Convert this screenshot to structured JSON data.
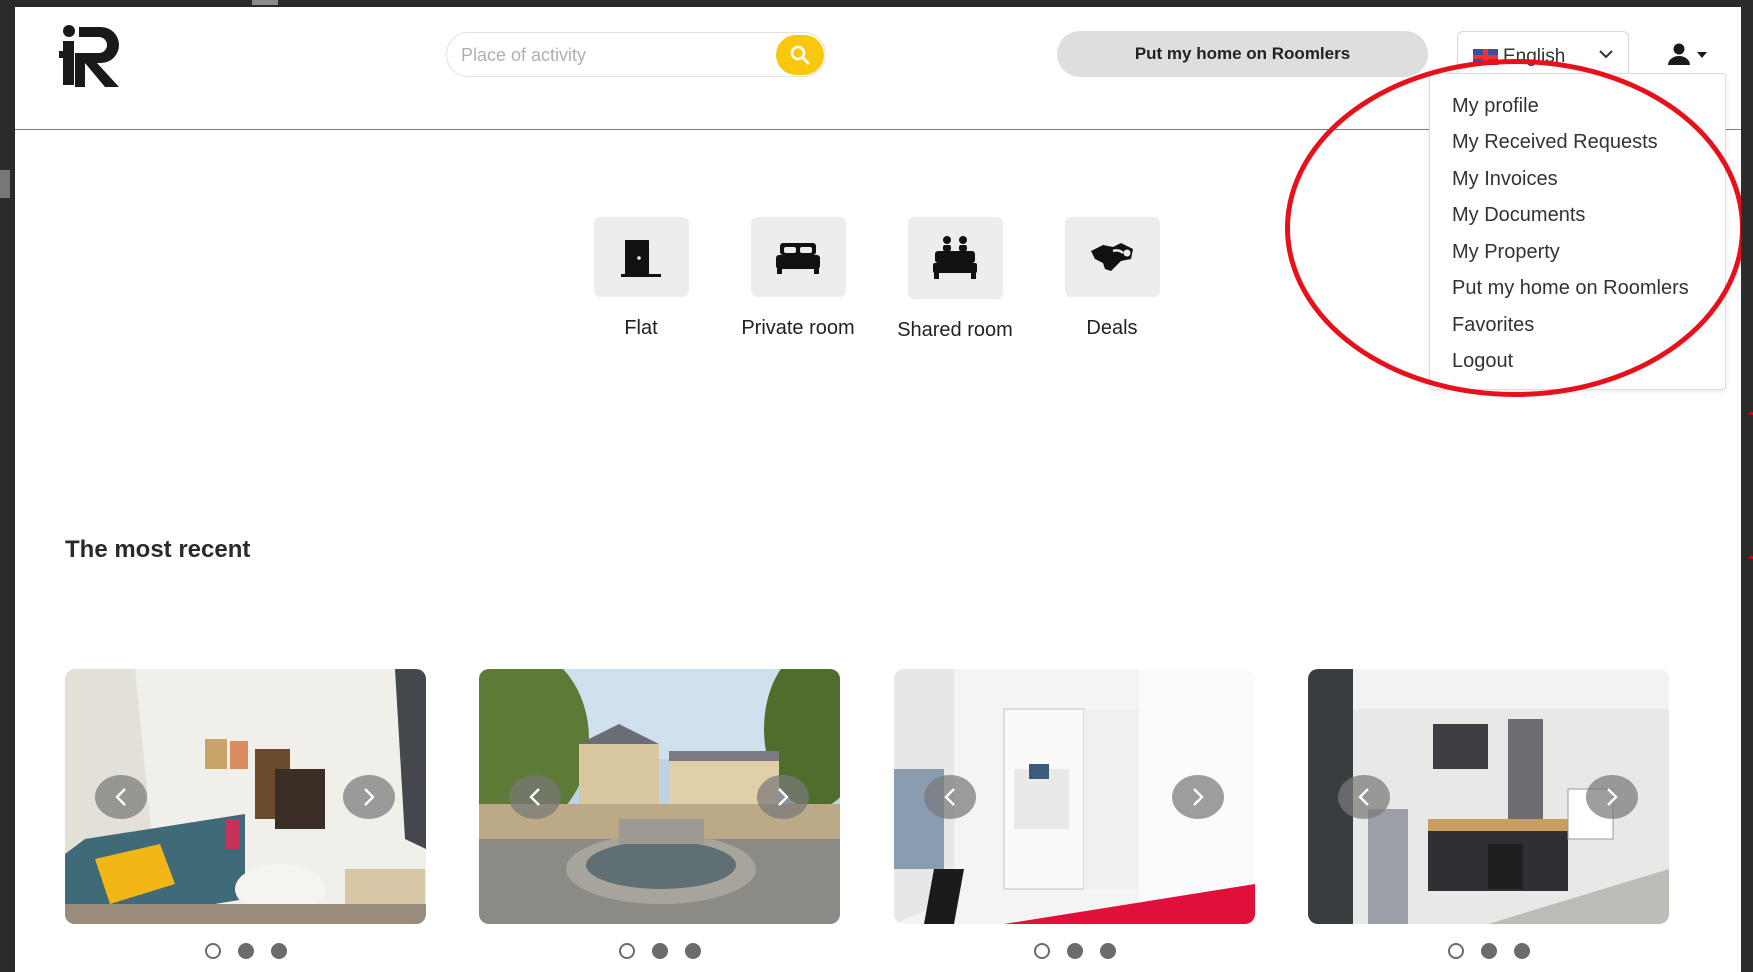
{
  "header": {
    "logo_alt": "Roomlers",
    "search_placeholder": "Place of activity",
    "put_home_label": "Put my home on Roomlers",
    "language_label": "English"
  },
  "user_menu": {
    "items": [
      "My profile",
      "My Received Requests",
      "My Invoices",
      "My Documents",
      "My Property",
      "Put my home on Roomlers",
      "Favorites",
      "Logout"
    ]
  },
  "categories": [
    {
      "label": "Flat",
      "icon": "door-icon"
    },
    {
      "label": "Private room",
      "icon": "bed-icon"
    },
    {
      "label": "Shared room",
      "icon": "shared-bed-icon"
    },
    {
      "label": "Deals",
      "icon": "handshake-icon"
    }
  ],
  "section": {
    "title": "The most recent"
  },
  "listings": [
    {
      "photo": "living-room",
      "active_dot": 0,
      "dot_count": 3
    },
    {
      "photo": "city-fountain",
      "active_dot": 0,
      "dot_count": 3
    },
    {
      "photo": "white-bedroom",
      "active_dot": 0,
      "dot_count": 3
    },
    {
      "photo": "kitchen",
      "active_dot": 0,
      "dot_count": 3
    }
  ],
  "colors": {
    "accent_yellow": "#f9c80e",
    "annotation_red": "#e8101a"
  }
}
